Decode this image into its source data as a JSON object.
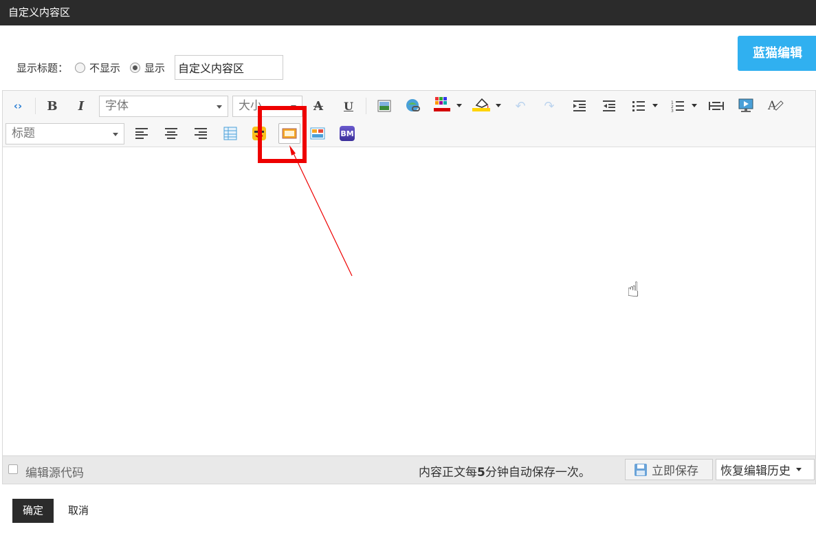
{
  "dialog": {
    "title": "自定义内容区"
  },
  "bm_editor_button": "蓝猫编辑",
  "title_settings": {
    "label": "显示标题：",
    "options": [
      {
        "label": "不显示",
        "selected": false
      },
      {
        "label": "显示",
        "selected": true
      }
    ],
    "title_value": "自定义内容区"
  },
  "toolbar": {
    "font_select": "字体",
    "size_select": "大小",
    "heading_select": "标题",
    "icons": [
      "source-code",
      "bold",
      "italic",
      "strikethrough",
      "underline",
      "image",
      "link",
      "font-color",
      "background-color",
      "undo",
      "redo",
      "indent",
      "outdent",
      "unordered-list",
      "ordered-list",
      "horizontal-rule",
      "media",
      "format-painter",
      "align-left",
      "align-center",
      "align-right",
      "table",
      "emoticon",
      "frame",
      "layout",
      "bm"
    ],
    "bold_glyph": "B",
    "italic_glyph": "I",
    "strike_glyph": "A",
    "underline_glyph": "U",
    "bm_glyph": "BM",
    "font_color": "#d40000",
    "bg_color": "#ffd400"
  },
  "statusbar": {
    "edit_source_label": "编辑源代码",
    "autosave_text_a": "内容正文每",
    "autosave_minutes": "5",
    "autosave_text_b": "分钟自动保存一次。",
    "save_now": "立即保存",
    "restore_history": "恢复编辑历史"
  },
  "actions": {
    "ok": "确定",
    "cancel": "取消"
  },
  "annotation": {
    "color": "#ee0000"
  }
}
